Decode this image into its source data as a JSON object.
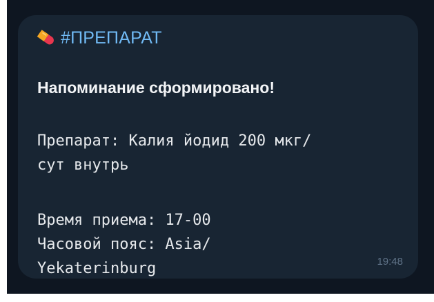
{
  "message": {
    "hashtag": "#ПРЕПАРАТ",
    "headline": "Напоминание сформировано!",
    "drug_line_1": "Препарат: Калия йодид 200 мкг/",
    "drug_line_2": "сут внутрь",
    "time_line": "Время приема: 17-00",
    "timezone_line_1": "Часовой пояс: Asia/",
    "timezone_line_2": "Yekaterinburg",
    "timestamp": "19:48"
  },
  "icons": {
    "hashtag_icon": "pill-icon"
  },
  "colors": {
    "chat_background": "#0e1621",
    "bubble": "#182533",
    "hashtag_link": "#71baf4",
    "text": "#e6e9ec",
    "timestamp": "#5f7287"
  }
}
